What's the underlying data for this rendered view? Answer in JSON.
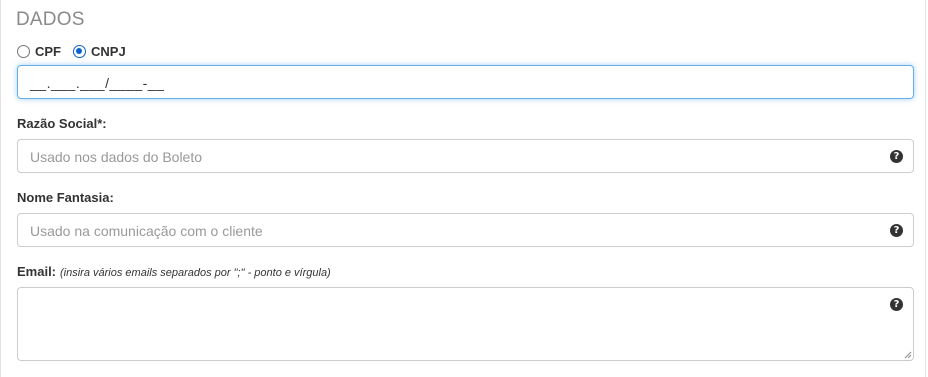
{
  "section": {
    "title": "DADOS"
  },
  "doc_type": {
    "options": [
      {
        "label": "CPF",
        "checked": false
      },
      {
        "label": "CNPJ",
        "checked": true
      }
    ]
  },
  "document_input": {
    "value": "__.___.___/____-__"
  },
  "razao_social": {
    "label": "Razão Social*:",
    "placeholder": "Usado nos dados do Boleto"
  },
  "nome_fantasia": {
    "label": "Nome Fantasia:",
    "placeholder": "Usado na comunicação com o cliente"
  },
  "email": {
    "label": "Email:",
    "hint": "(insira vários emails separados por \";\" - ponto e vírgula)",
    "value": ""
  },
  "icons": {
    "help": "question-circle-icon",
    "help_glyph": "?"
  }
}
